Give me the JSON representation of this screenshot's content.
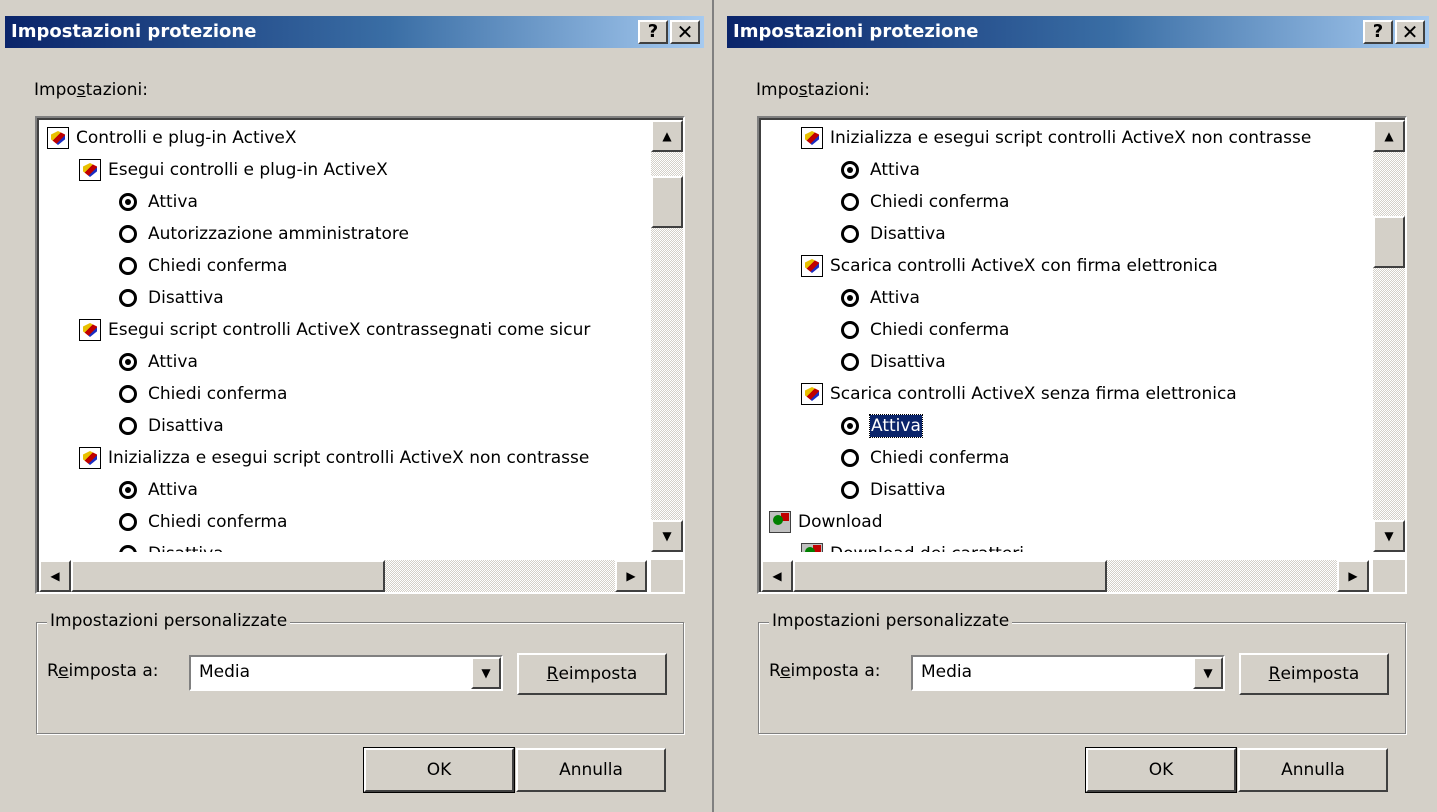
{
  "left": {
    "title": "Impostazioni protezione",
    "help_label": "?",
    "close_label": "✕",
    "settings_label_pre": "Impo",
    "settings_label_u": "s",
    "settings_label_post": "tazioni:",
    "items": [
      {
        "type": "group",
        "label": "Controlli e plug-in ActiveX",
        "icon": "shield-icon",
        "indent": 0
      },
      {
        "type": "setting",
        "label": "Esegui controlli e plug-in ActiveX",
        "icon": "shield-icon",
        "indent": 1
      },
      {
        "type": "option",
        "label": "Attiva",
        "checked": true,
        "indent": 2
      },
      {
        "type": "option",
        "label": "Autorizzazione amministratore",
        "checked": false,
        "indent": 2
      },
      {
        "type": "option",
        "label": "Chiedi conferma",
        "checked": false,
        "indent": 2
      },
      {
        "type": "option",
        "label": "Disattiva",
        "checked": false,
        "indent": 2
      },
      {
        "type": "setting",
        "label": "Esegui script controlli ActiveX contrassegnati come sicur",
        "icon": "shield-icon",
        "indent": 1
      },
      {
        "type": "option",
        "label": "Attiva",
        "checked": true,
        "indent": 2
      },
      {
        "type": "option",
        "label": "Chiedi conferma",
        "checked": false,
        "indent": 2
      },
      {
        "type": "option",
        "label": "Disattiva",
        "checked": false,
        "indent": 2
      },
      {
        "type": "setting",
        "label": "Inizializza e esegui script controlli ActiveX non contrasse",
        "icon": "shield-icon",
        "indent": 1
      },
      {
        "type": "option",
        "label": "Attiva",
        "checked": true,
        "indent": 2
      },
      {
        "type": "option",
        "label": "Chiedi conferma",
        "checked": false,
        "indent": 2
      },
      {
        "type": "option",
        "label": "Disattiva",
        "checked": false,
        "indent": 2
      }
    ],
    "group_title": "Impostazioni personalizzate",
    "reset_label_pre": "R",
    "reset_label_u": "e",
    "reset_label_post": "imposta a:",
    "reset_value": "Media",
    "reset_button_u": "R",
    "reset_button_post": "eimposta",
    "ok_label": "OK",
    "cancel_label": "Annulla",
    "vscroll_position": 0.12,
    "hscroll_position": 0.0
  },
  "right": {
    "title": "Impostazioni protezione",
    "help_label": "?",
    "close_label": "✕",
    "settings_label_pre": "Impo",
    "settings_label_u": "s",
    "settings_label_post": "tazioni:",
    "items": [
      {
        "type": "setting",
        "label": "Inizializza e esegui script controlli ActiveX non contrasse",
        "icon": "shield-icon",
        "indent": 1
      },
      {
        "type": "option",
        "label": "Attiva",
        "checked": true,
        "indent": 2
      },
      {
        "type": "option",
        "label": "Chiedi conferma",
        "checked": false,
        "indent": 2
      },
      {
        "type": "option",
        "label": "Disattiva",
        "checked": false,
        "indent": 2
      },
      {
        "type": "setting",
        "label": "Scarica controlli ActiveX con firma elettronica",
        "icon": "shield-icon",
        "indent": 1
      },
      {
        "type": "option",
        "label": "Attiva",
        "checked": true,
        "indent": 2
      },
      {
        "type": "option",
        "label": "Chiedi conferma",
        "checked": false,
        "indent": 2
      },
      {
        "type": "option",
        "label": "Disattiva",
        "checked": false,
        "indent": 2
      },
      {
        "type": "setting",
        "label": "Scarica controlli ActiveX senza firma elettronica",
        "icon": "shield-icon",
        "indent": 1
      },
      {
        "type": "option",
        "label": "Attiva",
        "checked": true,
        "selected": true,
        "indent": 2
      },
      {
        "type": "option",
        "label": "Chiedi conferma",
        "checked": false,
        "indent": 2
      },
      {
        "type": "option",
        "label": "Disattiva",
        "checked": false,
        "indent": 2
      },
      {
        "type": "group",
        "label": "Download",
        "icon": "download-icon",
        "indent": 0
      },
      {
        "type": "setting",
        "label": "Download dei caratteri",
        "icon": "download-icon",
        "indent": 1
      }
    ],
    "group_title": "Impostazioni personalizzate",
    "reset_label_pre": "R",
    "reset_label_u": "e",
    "reset_label_post": "imposta a:",
    "reset_value": "Media",
    "reset_button_u": "R",
    "reset_button_post": "eimposta",
    "ok_label": "OK",
    "cancel_label": "Annulla",
    "vscroll_position": 0.28,
    "hscroll_position": 0.0
  }
}
